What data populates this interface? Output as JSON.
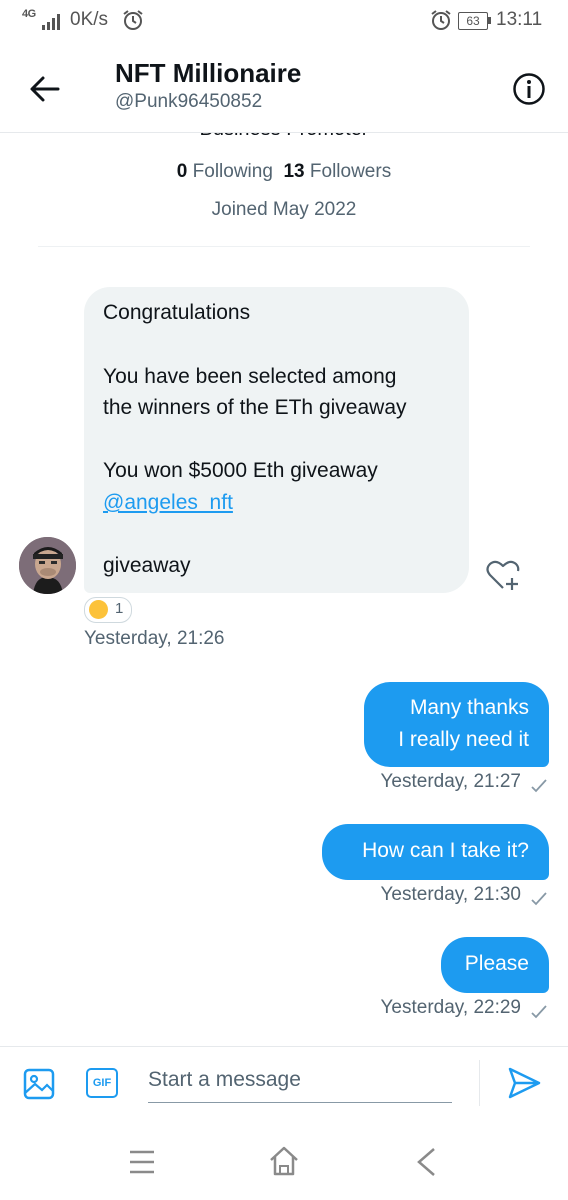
{
  "status_bar": {
    "network": "4G",
    "speed": "0K/s",
    "battery": "63",
    "time": "13:11"
  },
  "header": {
    "title": "NFT Millionaire",
    "handle": "@Punk96450852"
  },
  "profile": {
    "bio_partial": "Business Promoter",
    "following_count": "0",
    "following_label": "Following",
    "followers_count": "13",
    "followers_label": "Followers",
    "joined": "Joined May 2022"
  },
  "received_message": {
    "lines": [
      "Congratulations",
      "You have been  selected among",
      "the winners of the ETh giveaway",
      "You won $5000 Eth giveaway",
      "@angeles_nft",
      " giveaway"
    ],
    "reaction_count": "1",
    "timestamp": "Yesterday, 21:26"
  },
  "sent_messages": [
    {
      "lines": [
        "Many thanks",
        "I really need it"
      ],
      "timestamp": "Yesterday, 21:27"
    },
    {
      "lines": [
        "How can I take it?"
      ],
      "timestamp": "Yesterday, 21:30"
    },
    {
      "lines": [
        "Please"
      ],
      "timestamp": "Yesterday, 22:29"
    }
  ],
  "composer": {
    "placeholder": "Start a message",
    "gif_label": "GIF"
  },
  "colors": {
    "accent": "#1d9bf0",
    "received_bubble": "#eff3f4",
    "secondary_text": "#536471"
  },
  "icons": {
    "back": "arrow-left-icon",
    "info": "info-icon",
    "heart": "heart-plus-icon",
    "media": "image-icon",
    "send": "send-icon"
  }
}
